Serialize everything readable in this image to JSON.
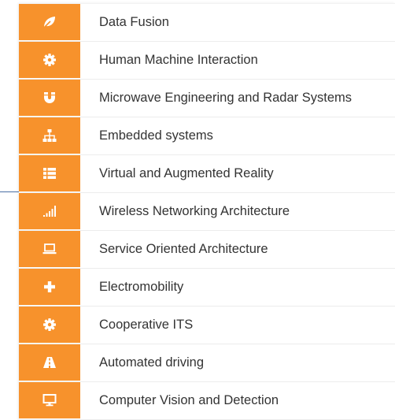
{
  "accent_color": "#f7922c",
  "items": [
    {
      "label": "Data Fusion",
      "icon": "leaf-icon"
    },
    {
      "label": "Human Machine Interaction",
      "icon": "gear-icon"
    },
    {
      "label": "Microwave Engineering and Radar Systems",
      "icon": "magnet-icon"
    },
    {
      "label": "Embedded systems",
      "icon": "sitemap-icon"
    },
    {
      "label": "Virtual and Augmented Reality",
      "icon": "list-icon"
    },
    {
      "label": "Wireless Networking Architecture",
      "icon": "signal-icon"
    },
    {
      "label": "Service Oriented Architecture",
      "icon": "laptop-icon"
    },
    {
      "label": "Electromobility",
      "icon": "plus-icon"
    },
    {
      "label": "Cooperative ITS",
      "icon": "gear-icon"
    },
    {
      "label": "Automated driving",
      "icon": "road-icon"
    },
    {
      "label": "Computer Vision and Detection",
      "icon": "desktop-icon"
    }
  ]
}
